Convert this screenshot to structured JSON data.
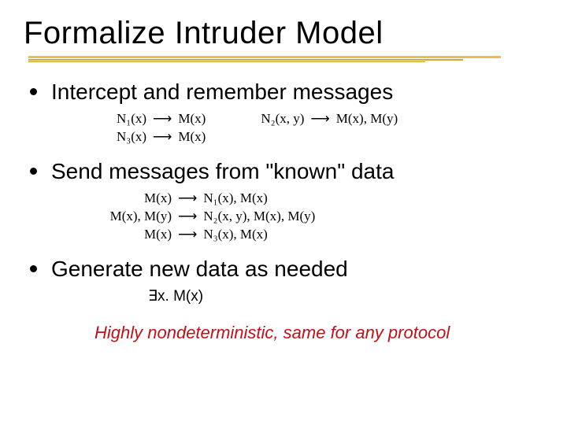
{
  "title": "Formalize Intruder Model",
  "bullets": {
    "b1": "Intercept and remember messages",
    "b2": "Send messages from \"known\" data",
    "b3": "Generate new data as needed"
  },
  "rules1": {
    "r1l": "N₁(x)",
    "r1a": "⟶",
    "r1r": "M(x)",
    "r1bl": "N₂(x, y)",
    "r1ba": "⟶",
    "r1br": "M(x), M(y)",
    "r2l": "N₃(x)",
    "r2a": "⟶",
    "r2r": "M(x)"
  },
  "rules2": {
    "r1l": "M(x)",
    "r1a": "⟶",
    "r1r": "N₁(x), M(x)",
    "r2l": "M(x), M(y)",
    "r2a": "⟶",
    "r2r": "N₂(x, y), M(x), M(y)",
    "r3l": "M(x)",
    "r3a": "⟶",
    "r3r": "N₃(x), M(x)"
  },
  "exists": "∃x. M(x)",
  "footer": "Highly nondeterministic, same for any protocol"
}
